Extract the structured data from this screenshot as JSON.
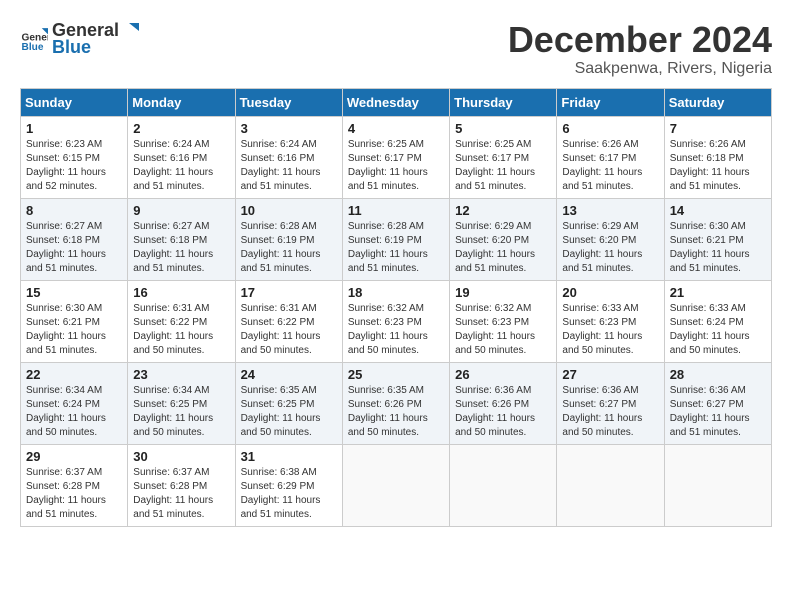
{
  "header": {
    "logo_general": "General",
    "logo_blue": "Blue",
    "month": "December 2024",
    "location": "Saakpenwa, Rivers, Nigeria"
  },
  "weekdays": [
    "Sunday",
    "Monday",
    "Tuesday",
    "Wednesday",
    "Thursday",
    "Friday",
    "Saturday"
  ],
  "weeks": [
    [
      {
        "day": "1",
        "info": "Sunrise: 6:23 AM\nSunset: 6:15 PM\nDaylight: 11 hours\nand 52 minutes."
      },
      {
        "day": "2",
        "info": "Sunrise: 6:24 AM\nSunset: 6:16 PM\nDaylight: 11 hours\nand 51 minutes."
      },
      {
        "day": "3",
        "info": "Sunrise: 6:24 AM\nSunset: 6:16 PM\nDaylight: 11 hours\nand 51 minutes."
      },
      {
        "day": "4",
        "info": "Sunrise: 6:25 AM\nSunset: 6:17 PM\nDaylight: 11 hours\nand 51 minutes."
      },
      {
        "day": "5",
        "info": "Sunrise: 6:25 AM\nSunset: 6:17 PM\nDaylight: 11 hours\nand 51 minutes."
      },
      {
        "day": "6",
        "info": "Sunrise: 6:26 AM\nSunset: 6:17 PM\nDaylight: 11 hours\nand 51 minutes."
      },
      {
        "day": "7",
        "info": "Sunrise: 6:26 AM\nSunset: 6:18 PM\nDaylight: 11 hours\nand 51 minutes."
      }
    ],
    [
      {
        "day": "8",
        "info": "Sunrise: 6:27 AM\nSunset: 6:18 PM\nDaylight: 11 hours\nand 51 minutes."
      },
      {
        "day": "9",
        "info": "Sunrise: 6:27 AM\nSunset: 6:18 PM\nDaylight: 11 hours\nand 51 minutes."
      },
      {
        "day": "10",
        "info": "Sunrise: 6:28 AM\nSunset: 6:19 PM\nDaylight: 11 hours\nand 51 minutes."
      },
      {
        "day": "11",
        "info": "Sunrise: 6:28 AM\nSunset: 6:19 PM\nDaylight: 11 hours\nand 51 minutes."
      },
      {
        "day": "12",
        "info": "Sunrise: 6:29 AM\nSunset: 6:20 PM\nDaylight: 11 hours\nand 51 minutes."
      },
      {
        "day": "13",
        "info": "Sunrise: 6:29 AM\nSunset: 6:20 PM\nDaylight: 11 hours\nand 51 minutes."
      },
      {
        "day": "14",
        "info": "Sunrise: 6:30 AM\nSunset: 6:21 PM\nDaylight: 11 hours\nand 51 minutes."
      }
    ],
    [
      {
        "day": "15",
        "info": "Sunrise: 6:30 AM\nSunset: 6:21 PM\nDaylight: 11 hours\nand 51 minutes."
      },
      {
        "day": "16",
        "info": "Sunrise: 6:31 AM\nSunset: 6:22 PM\nDaylight: 11 hours\nand 50 minutes."
      },
      {
        "day": "17",
        "info": "Sunrise: 6:31 AM\nSunset: 6:22 PM\nDaylight: 11 hours\nand 50 minutes."
      },
      {
        "day": "18",
        "info": "Sunrise: 6:32 AM\nSunset: 6:23 PM\nDaylight: 11 hours\nand 50 minutes."
      },
      {
        "day": "19",
        "info": "Sunrise: 6:32 AM\nSunset: 6:23 PM\nDaylight: 11 hours\nand 50 minutes."
      },
      {
        "day": "20",
        "info": "Sunrise: 6:33 AM\nSunset: 6:23 PM\nDaylight: 11 hours\nand 50 minutes."
      },
      {
        "day": "21",
        "info": "Sunrise: 6:33 AM\nSunset: 6:24 PM\nDaylight: 11 hours\nand 50 minutes."
      }
    ],
    [
      {
        "day": "22",
        "info": "Sunrise: 6:34 AM\nSunset: 6:24 PM\nDaylight: 11 hours\nand 50 minutes."
      },
      {
        "day": "23",
        "info": "Sunrise: 6:34 AM\nSunset: 6:25 PM\nDaylight: 11 hours\nand 50 minutes."
      },
      {
        "day": "24",
        "info": "Sunrise: 6:35 AM\nSunset: 6:25 PM\nDaylight: 11 hours\nand 50 minutes."
      },
      {
        "day": "25",
        "info": "Sunrise: 6:35 AM\nSunset: 6:26 PM\nDaylight: 11 hours\nand 50 minutes."
      },
      {
        "day": "26",
        "info": "Sunrise: 6:36 AM\nSunset: 6:26 PM\nDaylight: 11 hours\nand 50 minutes."
      },
      {
        "day": "27",
        "info": "Sunrise: 6:36 AM\nSunset: 6:27 PM\nDaylight: 11 hours\nand 50 minutes."
      },
      {
        "day": "28",
        "info": "Sunrise: 6:36 AM\nSunset: 6:27 PM\nDaylight: 11 hours\nand 51 minutes."
      }
    ],
    [
      {
        "day": "29",
        "info": "Sunrise: 6:37 AM\nSunset: 6:28 PM\nDaylight: 11 hours\nand 51 minutes."
      },
      {
        "day": "30",
        "info": "Sunrise: 6:37 AM\nSunset: 6:28 PM\nDaylight: 11 hours\nand 51 minutes."
      },
      {
        "day": "31",
        "info": "Sunrise: 6:38 AM\nSunset: 6:29 PM\nDaylight: 11 hours\nand 51 minutes."
      },
      null,
      null,
      null,
      null
    ]
  ]
}
